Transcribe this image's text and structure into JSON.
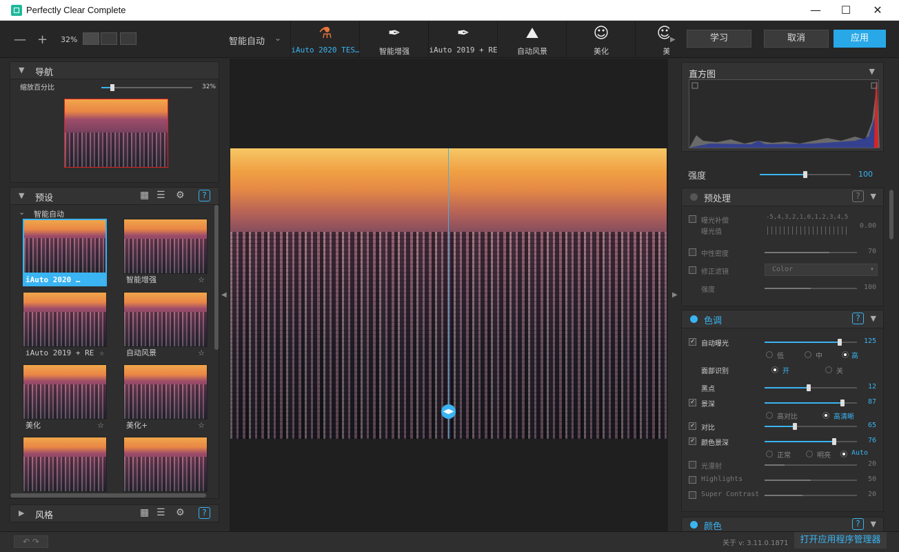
{
  "window": {
    "title": "Perfectly Clear Complete"
  },
  "toolbar": {
    "zoom_out": "—",
    "zoom_in": "+",
    "zoom": "32%",
    "preset_name": "智能自动",
    "tabs": [
      {
        "label": "iAuto 2020 TES…",
        "icon": "flask-icon"
      },
      {
        "label": "智能增强",
        "icon": "brush-2019-icon"
      },
      {
        "label": "iAuto 2019 + RE",
        "icon": "eye-brush-2019-icon"
      },
      {
        "label": "自动风景",
        "icon": "landscape-icon"
      },
      {
        "label": "美化",
        "icon": "face-icon"
      },
      {
        "label": "美",
        "icon": "face-icon"
      }
    ],
    "learn": "学习",
    "cancel": "取消",
    "apply": "应用"
  },
  "nav": {
    "title": "导航",
    "zoom_label": "缩放百分比",
    "zoom_value": "32%",
    "zoom_level": 0.12
  },
  "presets": {
    "title": "预设",
    "group": "智能自动",
    "items": [
      {
        "label": "iAuto 2020 …",
        "selected": true
      },
      {
        "label": "智能增强"
      },
      {
        "label": "iAuto 2019 + RE"
      },
      {
        "label": "自动风景"
      },
      {
        "label": "美化"
      },
      {
        "label": "美化+"
      },
      {
        "label": ""
      },
      {
        "label": ""
      }
    ]
  },
  "styles": {
    "title": "风格"
  },
  "histogram": {
    "title": "直方图"
  },
  "strength": {
    "label": "强度",
    "value": "100",
    "level": 0.5
  },
  "preprocess": {
    "title": "预处理",
    "exposure_comp": "曝光补偿",
    "exposure_scale": "-5,4,3,2,1,0,1,2,3,4,5",
    "exposure_value_label": "曝光值",
    "exposure_value": "0.00",
    "neutral_density": "中性密度",
    "neutral_density_value": "70",
    "neutral_density_level": 0.7,
    "correction_filter": "修正滤镜",
    "filter_option": "Color",
    "strength": "强度",
    "strength_value": "100",
    "strength_level": 0.5
  },
  "tone": {
    "title": "色调",
    "auto_exposure": "自动曝光",
    "auto_exposure_value": "125",
    "auto_exposure_level": 0.81,
    "ae_low": "低",
    "ae_mid": "中",
    "ae_high": "高",
    "face_detect": "面部识别",
    "face_on": "开",
    "face_off": "关",
    "black_point": "黑点",
    "black_point_value": "12",
    "black_point_level": 0.48,
    "depth": "景深",
    "depth_value": "87",
    "depth_level": 0.84,
    "high_contrast": "高对比",
    "high_clarity": "高清晰",
    "contrast": "对比",
    "contrast_value": "65",
    "contrast_level": 0.33,
    "color_depth": "颜色景深",
    "color_depth_value": "76",
    "color_depth_level": 0.75,
    "normal": "正常",
    "bright": "明亮",
    "auto": "Auto",
    "light_diffusion": "光漫射",
    "light_diffusion_value": "20",
    "light_diffusion_level": 0.22,
    "highlights": "Highlights",
    "highlights_value": "50",
    "highlights_level": 0.5,
    "super_contrast": "Super Contrast",
    "super_contrast_value": "20",
    "super_contrast_level": 0.41
  },
  "color": {
    "title": "颜色"
  },
  "status": {
    "version": "关于 v: 3.11.0.1871",
    "app_manager": "打开应用程序管理器"
  },
  "colors": {
    "accent": "#3ab4f2",
    "bg": "#2b2b2b"
  }
}
